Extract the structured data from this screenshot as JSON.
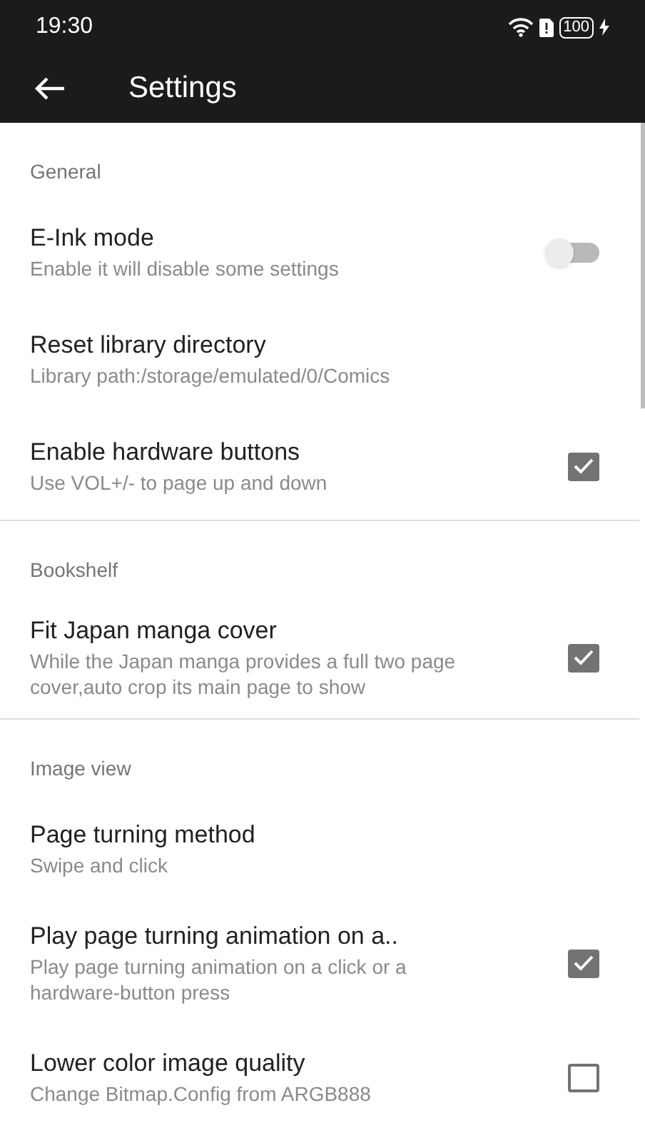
{
  "status_bar": {
    "time": "19:30",
    "battery": "100"
  },
  "app_bar": {
    "title": "Settings"
  },
  "sections": [
    {
      "header": "General",
      "items": [
        {
          "kind": "switch",
          "title": "E-Ink mode",
          "summary": "Enable it will disable some settings",
          "on": false
        },
        {
          "kind": "plain",
          "title": "Reset library directory",
          "summary": "Library path:/storage/emulated/0/Comics"
        },
        {
          "kind": "checkbox",
          "title": "Enable hardware buttons",
          "summary": "Use VOL+/- to page up and down",
          "checked": true
        }
      ]
    },
    {
      "header": "Bookshelf",
      "items": [
        {
          "kind": "checkbox",
          "title": "Fit Japan manga cover",
          "summary": "While the Japan manga provides a full two page cover,auto crop its main page to show",
          "checked": true
        }
      ]
    },
    {
      "header": "Image view",
      "items": [
        {
          "kind": "plain",
          "title": "Page turning method",
          "summary": "Swipe and click"
        },
        {
          "kind": "checkbox",
          "title": "Play page turning animation on a..",
          "summary": "Play page turning animation on a click or a hardware-button press",
          "checked": true
        },
        {
          "kind": "checkbox",
          "title": "Lower color image quality",
          "summary": "Change Bitmap.Config from ARGB888",
          "checked": false
        }
      ]
    }
  ]
}
